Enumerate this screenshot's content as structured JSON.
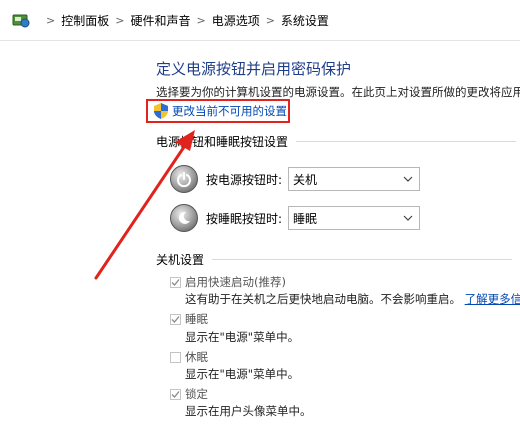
{
  "breadcrumb": {
    "items": [
      "控制面板",
      "硬件和声音",
      "电源选项",
      "系统设置"
    ],
    "separator": ">"
  },
  "page": {
    "title": "定义电源按钮并启用密码保护",
    "description": "选择要为你的计算机设置的电源设置。在此页上对设置所做的更改将应用于你",
    "change_link": "更改当前不可用的设置"
  },
  "buttons_section": {
    "heading": "电源按钮和睡眠按钮设置",
    "power_label": "按电源按钮时:",
    "power_value": "关机",
    "sleep_label": "按睡眠按钮时:",
    "sleep_value": "睡眠"
  },
  "shutdown_section": {
    "heading": "关机设置",
    "fast_startup_label": "启用快速启动(推荐)",
    "fast_startup_desc": "这有助于在关机之后更快地启动电脑。不会影响重启。",
    "learn_more": "了解更多信息",
    "sleep_label": "睡眠",
    "sleep_desc": "显示在\"电源\"菜单中。",
    "hibernate_label": "休眠",
    "hibernate_desc": "显示在\"电源\"菜单中。",
    "lock_label": "锁定",
    "lock_desc": "显示在用户头像菜单中。"
  },
  "options_state": {
    "fast_startup": true,
    "sleep": true,
    "hibernate": false,
    "lock": true
  },
  "colors": {
    "title": "#1e3e8a",
    "link": "#0048b4",
    "highlight": "#e0231c"
  },
  "icons": {
    "breadcrumb": "control-panel-icon",
    "shield": "uac-shield-icon",
    "power": "power-button-icon",
    "sleep": "sleep-button-icon",
    "dropdown": "chevron-down-icon"
  }
}
